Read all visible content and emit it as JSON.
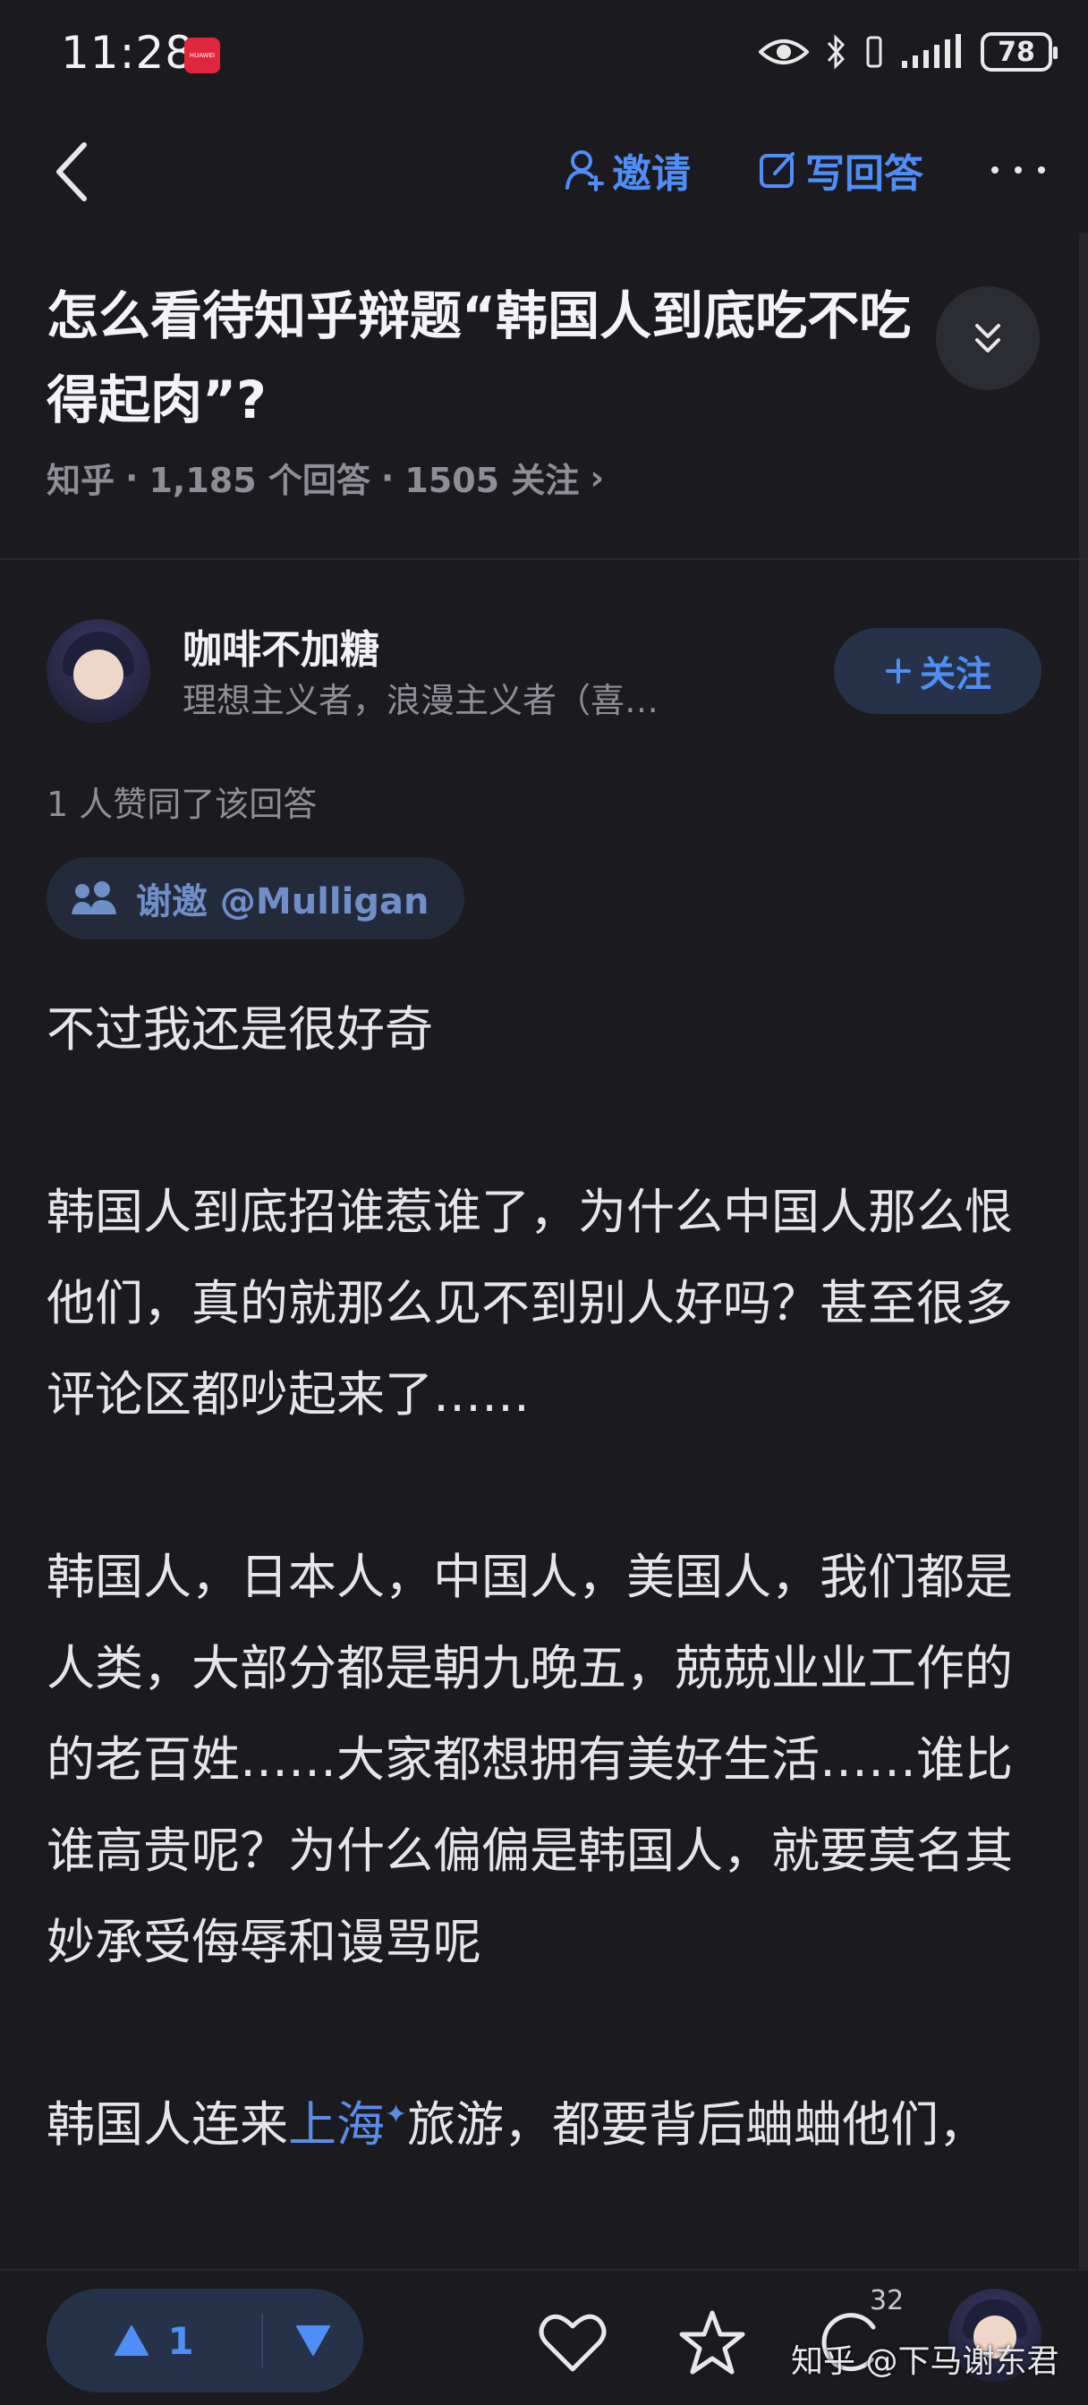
{
  "status_bar": {
    "time": "11:28",
    "badge": "HUAWEI",
    "battery": "78"
  },
  "nav": {
    "invite_label": "邀请",
    "write_answer_label": "写回答"
  },
  "question": {
    "title": "怎么看待知乎辩题“韩国人到底吃不吃得起肉”?",
    "meta_source": "知乎",
    "meta_answers": "1,185 个回答",
    "meta_follows": "1505 关注",
    "meta_sep": "·",
    "meta_chevron": "›"
  },
  "author": {
    "name": "咖啡不加糖",
    "bio": "理想主义者，浪漫主义者（喜…",
    "avatar_caption": "Author avatar",
    "follow_label": "关注"
  },
  "upvote_note": "1 人赞同了该回答",
  "thanks": {
    "label": "谢邀 @Mulligan"
  },
  "answer": {
    "p1": "不过我还是很好奇",
    "p2": "韩国人到底招谁惹谁了，为什么中国人那么恨他们，真的就那么见不到别人好吗？甚至很多评论区都吵起来了……",
    "p3": "韩国人，日本人，中国人，美国人，我们都是人类，大部分都是朝九晚五，兢兢业业工作的的老百姓……大家都想拥有美好生活……谁比谁高贵呢？为什么偏偏是韩国人，就要莫名其妙承受侮辱和谩骂呢",
    "p4_before": "韩国人连来",
    "p4_link": "上海",
    "p4_spark": "✦",
    "p4_after": "旅游，都要背后蛐蛐他们，"
  },
  "bottom_bar": {
    "upvote_count": "1",
    "comment_count": "32"
  },
  "watermark": "知乎 @下马谢东君",
  "colors": {
    "accent": "#4f8ef7",
    "background": "#1b1b1f",
    "muted_text": "#8e8f96"
  }
}
